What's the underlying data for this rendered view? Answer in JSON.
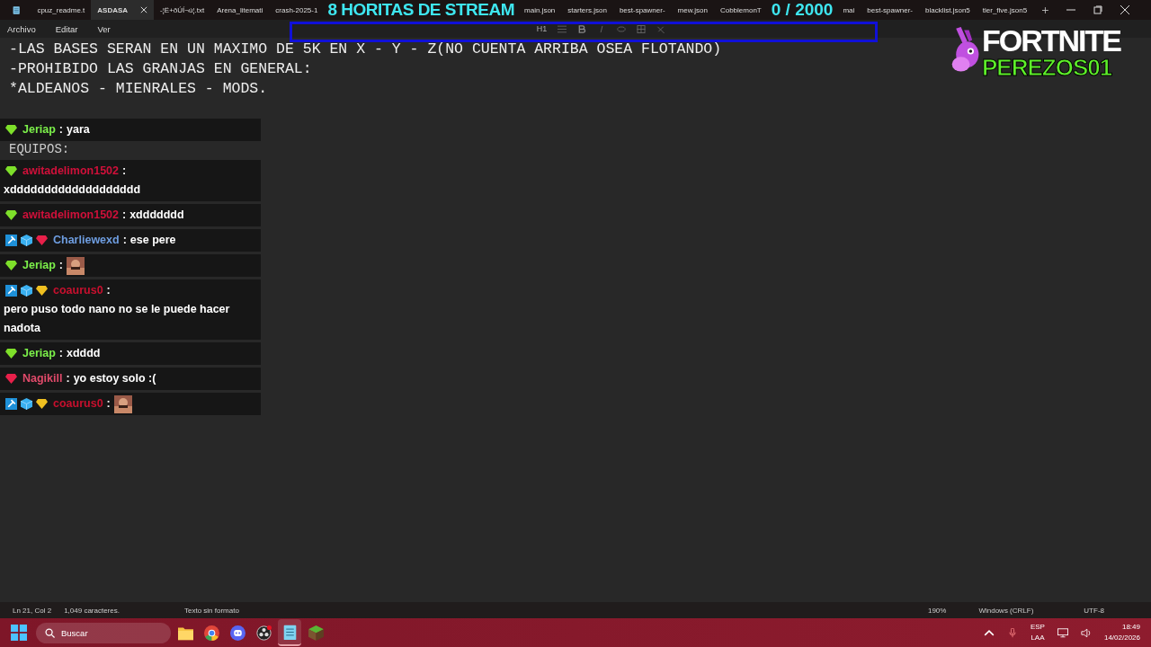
{
  "tabs": [
    {
      "label": "cpuz_readme.t",
      "selected": false
    },
    {
      "label": "ASDASA",
      "selected": true
    },
    {
      "label": "-¦Ë+ðÚÍ¬ú¦.txt",
      "selected": false
    },
    {
      "label": "Arena_litemati",
      "selected": false
    },
    {
      "label": "crash-2025-1",
      "selected": false
    },
    {
      "label": "main.json",
      "selected": false
    },
    {
      "label": "starters.json",
      "selected": false
    },
    {
      "label": "best-spawner-",
      "selected": false
    },
    {
      "label": "mew.json",
      "selected": false
    },
    {
      "label": "CobblemonT",
      "selected": false
    },
    {
      "label": "mai",
      "selected": false
    },
    {
      "label": "best-spawner-",
      "selected": false
    },
    {
      "label": "blacklist.json5",
      "selected": false
    },
    {
      "label": "tier_five.json5",
      "selected": false
    }
  ],
  "overlay": {
    "title": "8 HORITAS DE STREAM",
    "counter": "0 / 2000",
    "logo_top": "FORTNITE",
    "logo_bottom": "PEREZOS01"
  },
  "menu": [
    "Archivo",
    "Editar",
    "Ver"
  ],
  "toolbar": {
    "heading": "H1"
  },
  "editor": {
    "lines": [
      "-LAS BASES SERAN EN UN MAXIMO DE 5K EN X - Y - Z(NO CUENTA ARRIBA OSEA FLOTANDO)",
      "-PROHIBIDO LAS GRANJAS EN GENERAL:",
      "*ALDEANOS - MIENRALES - MODS.",
      "EQUIPOS:"
    ]
  },
  "chat": [
    {
      "badges": [
        {
          "kind": "gem",
          "color": "#7ee02a"
        }
      ],
      "user": "Jeriap",
      "color": "#7cf04a",
      "separator": ":",
      "text": "yara"
    },
    {
      "badges": [
        {
          "kind": "gem",
          "color": "#7ee02a"
        }
      ],
      "user": "awitadelimon1502",
      "color": "#d0103a",
      "separator": ":",
      "text": "xddddddddddddddddddd"
    },
    {
      "badges": [
        {
          "kind": "gem",
          "color": "#7ee02a"
        }
      ],
      "user": "awitadelimon1502",
      "color": "#d0103a",
      "separator": ":",
      "text": "xddddddd"
    },
    {
      "badges": [
        {
          "kind": "mod"
        },
        {
          "kind": "cube"
        },
        {
          "kind": "gem",
          "color": "#e8204a"
        }
      ],
      "user": "Charliewexd",
      "color": "#6e9de0",
      "separator": ":",
      "text": "ese pere"
    },
    {
      "badges": [
        {
          "kind": "gem",
          "color": "#7ee02a"
        }
      ],
      "user": "Jeriap",
      "color": "#7cf04a",
      "separator": ":",
      "emote": true
    },
    {
      "badges": [
        {
          "kind": "mod"
        },
        {
          "kind": "cube"
        },
        {
          "kind": "gem",
          "color": "#f0c020"
        }
      ],
      "user": "coaurus0",
      "color": "#c8102e",
      "separator": ":",
      "text": "pero puso todo nano no se le puede hacer nadota"
    },
    {
      "badges": [
        {
          "kind": "gem",
          "color": "#7ee02a"
        }
      ],
      "user": "Jeriap",
      "color": "#7cf04a",
      "separator": ":",
      "text": "xdddd"
    },
    {
      "badges": [
        {
          "kind": "gem",
          "color": "#e8204a"
        }
      ],
      "user": "Nagikill",
      "color": "#e04a6a",
      "separator": ":",
      "text": "yo estoy solo :("
    },
    {
      "badges": [
        {
          "kind": "mod"
        },
        {
          "kind": "cube"
        },
        {
          "kind": "gem",
          "color": "#f0c020"
        }
      ],
      "user": "coaurus0",
      "color": "#c8102e",
      "separator": ":",
      "emote": true
    }
  ],
  "status_bar": {
    "position": "Ln 21, Col 2",
    "count": "1,049 caracteres.",
    "format": "Texto sin formato",
    "zoom": "190%",
    "line_ending": "Windows (CRLF)",
    "encoding": "UTF-8"
  },
  "taskbar": {
    "search_placeholder": "Buscar",
    "apps": [
      {
        "kind": "folder",
        "selected": false
      },
      {
        "kind": "browser",
        "selected": false
      },
      {
        "kind": "chat",
        "selected": false
      },
      {
        "kind": "recorder",
        "selected": false
      },
      {
        "kind": "notepad",
        "selected": true
      },
      {
        "kind": "block",
        "selected": false
      }
    ],
    "language": "ESP",
    "layout": "LAA",
    "time": "18:49",
    "date": "14/02/2026"
  }
}
